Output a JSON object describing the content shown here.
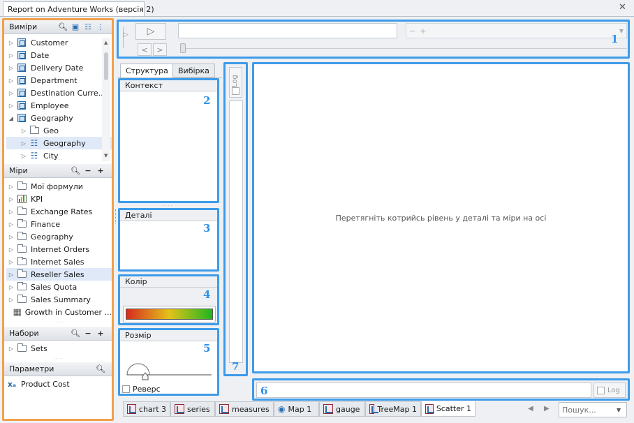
{
  "window": {
    "tab_title": "Report on Adventure Works (версія 2)",
    "close_glyph": "✕"
  },
  "dimensions": {
    "title": "Виміри",
    "items": [
      {
        "label": "Customer",
        "level": 0,
        "icon": "cube-icon"
      },
      {
        "label": "Date",
        "level": 0,
        "icon": "cube-icon"
      },
      {
        "label": "Delivery Date",
        "level": 0,
        "icon": "cube-icon"
      },
      {
        "label": "Department",
        "level": 0,
        "icon": "cube-icon"
      },
      {
        "label": "Destination Curre...",
        "level": 0,
        "icon": "cube-icon"
      },
      {
        "label": "Employee",
        "level": 0,
        "icon": "cube-icon"
      },
      {
        "label": "Geography",
        "level": 0,
        "icon": "cube-icon",
        "expanded": true
      },
      {
        "label": "Geo",
        "level": 1,
        "icon": "folder-icon"
      },
      {
        "label": "Geography",
        "level": 1,
        "icon": "hierarchy-icon",
        "selected": true
      },
      {
        "label": "City",
        "level": 1,
        "icon": "level-icon"
      }
    ]
  },
  "measures": {
    "title": "Міри",
    "items": [
      {
        "label": "Мої формули",
        "icon": "folder-icon"
      },
      {
        "label": "KPI",
        "icon": "kpi-icon"
      },
      {
        "label": "Exchange Rates",
        "icon": "folder-icon"
      },
      {
        "label": "Finance",
        "icon": "folder-icon"
      },
      {
        "label": "Geography",
        "icon": "folder-icon"
      },
      {
        "label": "Internet Orders",
        "icon": "folder-icon"
      },
      {
        "label": "Internet Sales",
        "icon": "folder-icon"
      },
      {
        "label": "Reseller Sales",
        "icon": "folder-icon",
        "selected": true
      },
      {
        "label": "Sales Quota",
        "icon": "folder-icon"
      },
      {
        "label": "Sales Summary",
        "icon": "folder-icon"
      },
      {
        "label": "Growth in Customer ...",
        "icon": "calculator-icon"
      }
    ]
  },
  "sets": {
    "title": "Набори",
    "items": [
      {
        "label": "Sets",
        "icon": "folder-icon"
      }
    ]
  },
  "parameters": {
    "title": "Параметри",
    "items": [
      {
        "label": "Product Cost",
        "icon": "parameter-icon"
      }
    ]
  },
  "player": {
    "minus": "−",
    "plus": "+",
    "number_label": "1"
  },
  "structure": {
    "tabs": [
      "Структура",
      "Вибірка"
    ],
    "context_label": "Контекст",
    "context_number": "2",
    "details_label": "Деталі",
    "details_number": "3",
    "color_label": "Колір",
    "color_number": "4",
    "size_label": "Розмір",
    "size_number": "5",
    "reverse_label": "Реверс"
  },
  "axis_y": {
    "log_label": "Log",
    "number": "7"
  },
  "axis_x": {
    "log_label": "Log",
    "number": "6"
  },
  "chart": {
    "placeholder": "Перетягніть котрийсь рівень у деталі та міри на осі"
  },
  "bottom_tabs": [
    {
      "label": "chart 3",
      "icon": "chart-icon"
    },
    {
      "label": "series",
      "icon": "chart-icon"
    },
    {
      "label": "measures",
      "icon": "chart-icon"
    },
    {
      "label": "Map 1",
      "icon": "map-pin-icon"
    },
    {
      "label": "gauge",
      "icon": "chart-icon"
    },
    {
      "label": "TreeMap 1",
      "icon": "treemap-icon"
    },
    {
      "label": "Scatter 1",
      "icon": "scatter-icon",
      "active": true
    }
  ],
  "search": {
    "placeholder": "Пошук..."
  },
  "colors": {
    "orange_highlight": "#f0a04b",
    "blue_highlight": "#3d9be9",
    "gradient": [
      "#d62b1f",
      "#e3c21a",
      "#1fb61f"
    ]
  }
}
